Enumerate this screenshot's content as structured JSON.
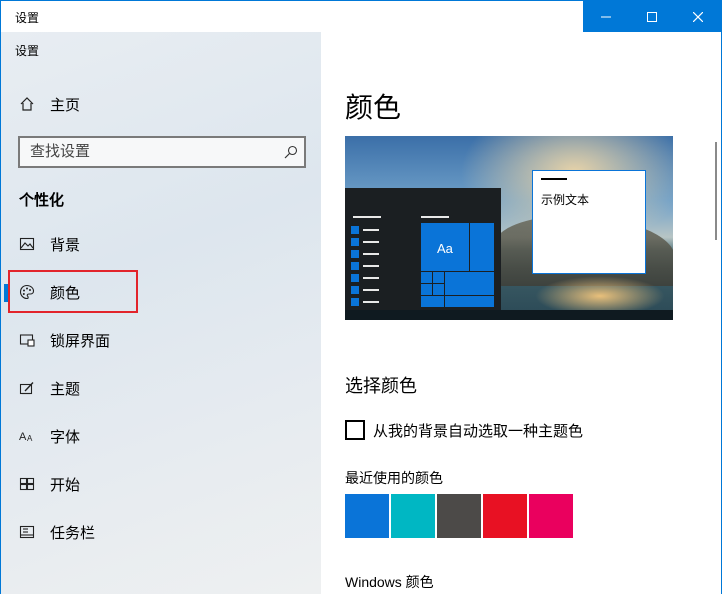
{
  "window": {
    "title": "设置",
    "controls": {
      "minimize_icon": "minimize-icon",
      "maximize_icon": "maximize-icon",
      "close_icon": "close-icon"
    }
  },
  "sidebar": {
    "app_title": "设置",
    "home": {
      "label": "主页",
      "icon": "home-icon"
    },
    "search": {
      "placeholder": "查找设置",
      "icon": "search-icon"
    },
    "section_title": "个性化",
    "items": [
      {
        "label": "背景",
        "icon": "picture-icon"
      },
      {
        "label": "颜色",
        "icon": "palette-icon",
        "selected": true
      },
      {
        "label": "锁屏界面",
        "icon": "lockscreen-icon"
      },
      {
        "label": "主题",
        "icon": "theme-icon"
      },
      {
        "label": "字体",
        "icon": "font-icon"
      },
      {
        "label": "开始",
        "icon": "start-icon"
      },
      {
        "label": "任务栏",
        "icon": "taskbar-icon"
      }
    ]
  },
  "main": {
    "title": "颜色",
    "preview": {
      "tile_text": "Aa",
      "sample_text": "示例文本"
    },
    "choose_color_title": "选择颜色",
    "auto_pick_label": "从我的背景自动选取一种主题色",
    "auto_pick_checked": false,
    "recent_colors_title": "最近使用的颜色",
    "recent_colors": [
      "#0a74d8",
      "#00b7c3",
      "#4c4a48",
      "#e81123",
      "#ea005e"
    ],
    "windows_colors_title": "Windows 颜色"
  },
  "colors": {
    "accent": "#0078d7",
    "highlight_box": "#e2242b"
  }
}
